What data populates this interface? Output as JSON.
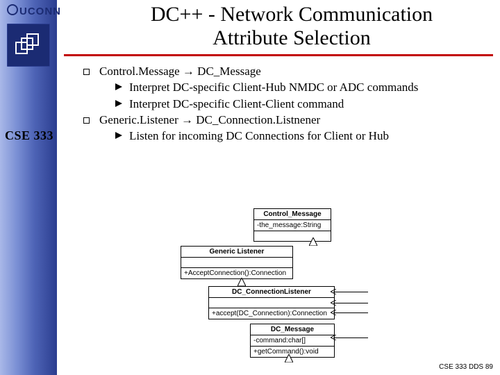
{
  "brand": "UCONN",
  "course": "CSE 333",
  "title_line1": "DC++ - Network Communication",
  "title_line2": "Attribute Selection",
  "bullets": [
    {
      "label": "Control.Message → DC_Message",
      "subs": [
        "Interpret DC-specific Client-Hub NMDC or ADC commands",
        "Interpret DC-specific Client-Client command"
      ]
    },
    {
      "label": "Generic.Listener → DC_Connection.Listnener",
      "subs": [
        "Listen for incoming DC Connections for Client or Hub"
      ]
    }
  ],
  "uml": {
    "control_message": {
      "name": "Control_Message",
      "attr": "-the_message:String"
    },
    "generic_listener": {
      "name": "Generic Listener",
      "op": "+AcceptConnection():Connection"
    },
    "dc_conn_listener": {
      "name": "DC_ConnectionListener",
      "op": "+accept(DC_Connection):Connection"
    },
    "dc_message": {
      "name": "DC_Message",
      "attr": "-command:char[]",
      "op": "+getCommand():void"
    }
  },
  "footer": "CSE 333 DDS 89"
}
